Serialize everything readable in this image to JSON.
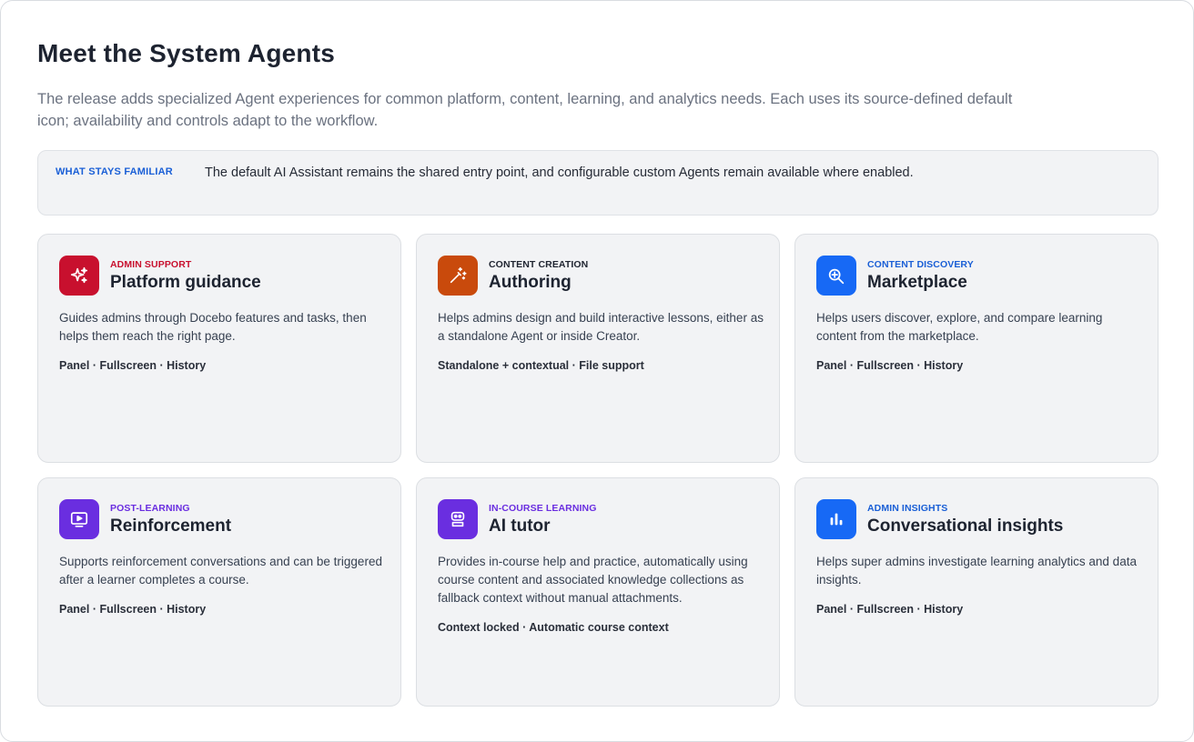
{
  "page": {
    "title": "Meet the System Agents",
    "subtitle": "The release adds specialized Agent experiences for common platform, content, learning, and analytics needs. Each uses its source-defined default icon; availability and controls adapt to the workflow."
  },
  "familiar": {
    "label": "WHAT STAYS FAMILIAR",
    "text": "The default AI Assistant remains the shared entry point, and configurable custom Agents remain available where enabled."
  },
  "cards": [
    {
      "category": "ADMIN SUPPORT",
      "title": "Platform guidance",
      "description": "Guides admins through Docebo features and tasks, then helps them reach the right page.",
      "tags": "Panel · Fullscreen · History",
      "icon": "sparkles-icon",
      "icon_color": "#c8102e",
      "category_color": "#c8102e"
    },
    {
      "category": "CONTENT CREATION",
      "title": "Authoring",
      "description": "Helps admins design and build interactive lessons, either as a standalone Agent or inside Creator.",
      "tags": "Standalone + contextual · File support",
      "icon": "magic-wand-icon",
      "icon_color": "#c94a0c",
      "category_color": "#1f2430"
    },
    {
      "category": "CONTENT DISCOVERY",
      "title": "Marketplace",
      "description": "Helps users discover, explore, and compare learning content from the marketplace.",
      "tags": "Panel · Fullscreen · History",
      "icon": "search-sparkle-icon",
      "icon_color": "#1769f5",
      "category_color": "#1a5fd6"
    },
    {
      "category": "POST-LEARNING",
      "title": "Reinforcement",
      "description": "Supports reinforcement conversations and can be triggered after a learner completes a course.",
      "tags": "Panel · Fullscreen · History",
      "icon": "play-screen-icon",
      "icon_color": "#6a2ee0",
      "category_color": "#6a2ee0"
    },
    {
      "category": "IN-COURSE LEARNING",
      "title": "AI tutor",
      "description": "Provides in-course help and practice, automatically using course content and associated knowledge collections as fallback context without manual attachments.",
      "tags": "Context locked · Automatic course context",
      "icon": "robot-icon",
      "icon_color": "#6a2ee0",
      "category_color": "#6a2ee0"
    },
    {
      "category": "ADMIN INSIGHTS",
      "title": "Conversational insights",
      "description": "Helps super admins investigate learning analytics and data insights.",
      "tags": "Panel · Fullscreen · History",
      "icon": "bar-chart-icon",
      "icon_color": "#1769f5",
      "category_color": "#1a5fd6"
    }
  ]
}
